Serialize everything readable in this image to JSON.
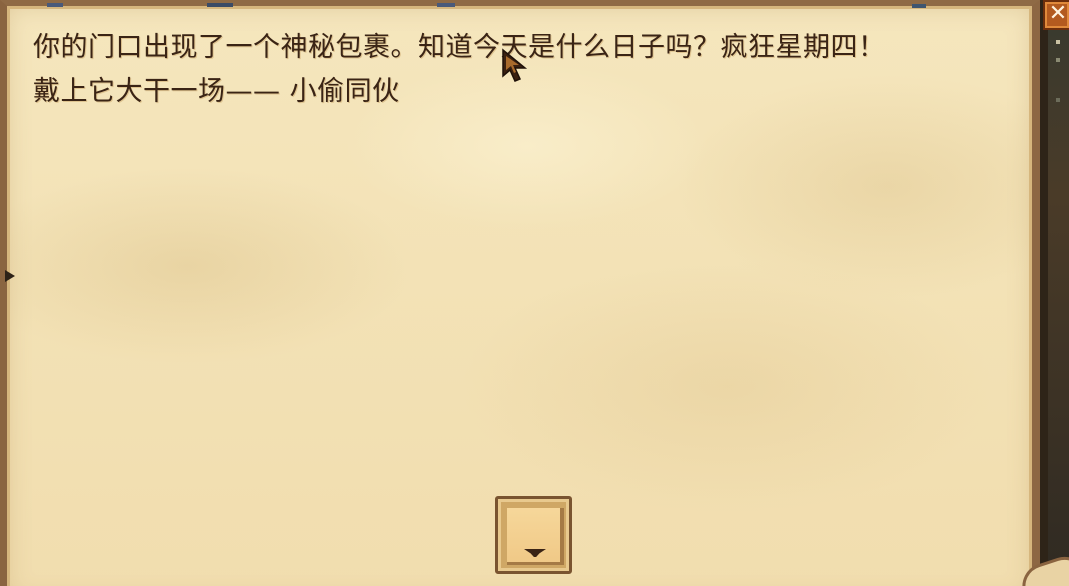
{
  "letter": {
    "message": "你的门口出现了一个神秘包裹。知道今天是什么日子吗？疯狂星期四！\n戴上它大干一场—— 小偷同伙"
  },
  "buttons": {
    "close_label": "✕",
    "scroll_down_icon": "chevron-down-icon"
  },
  "icons": {
    "cursor": "arrow-cursor-icon",
    "close": "close-icon"
  },
  "colors": {
    "parchment": "#f3e2b6",
    "text": "#3a2415",
    "close_button": "#b35a1f",
    "button_face": "#f0c987"
  }
}
